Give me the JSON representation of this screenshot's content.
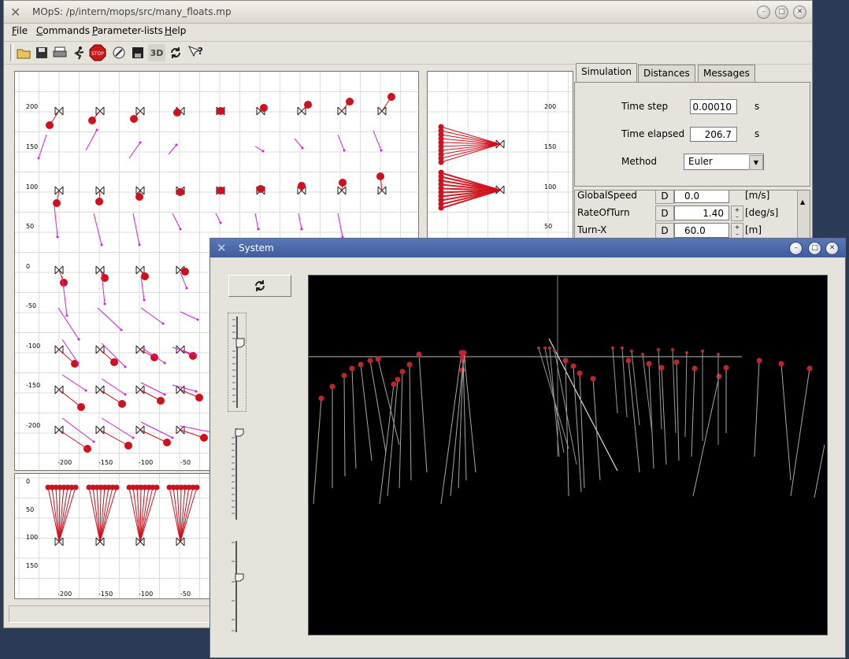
{
  "main_window": {
    "title": "MOpS: /p/intern/mops/src/many_floats.mp",
    "menu": [
      {
        "label": "File"
      },
      {
        "label": "Commands"
      },
      {
        "label": "Parameter-lists"
      },
      {
        "label": "Help"
      }
    ],
    "toolbar_icons": [
      "open-folder-icon",
      "save-icon",
      "print-icon",
      "run-icon",
      "stop-icon",
      "brush-icon",
      "disk-icon",
      "3d-icon",
      "refresh-icon",
      "help-icon"
    ],
    "toolbar_3d_label": "3D",
    "toolbar_stop_label": "STOP"
  },
  "plan_view": {
    "y_ticks": [
      "200",
      "150",
      "100",
      "50",
      "0",
      "-50",
      "-100",
      "-150",
      "-200"
    ],
    "x_ticks": [
      "-200",
      "-150",
      "-100",
      "-50"
    ]
  },
  "side_view": {
    "y_ticks": [
      "200",
      "150",
      "100",
      "50"
    ]
  },
  "front_view": {
    "y_ticks": [
      "0",
      "50",
      "100",
      "150"
    ],
    "x_ticks": [
      "-200",
      "-150",
      "-100",
      "-50"
    ]
  },
  "tabs": [
    {
      "label": "Simulation"
    },
    {
      "label": "Distances"
    },
    {
      "label": "Messages"
    }
  ],
  "simulation": {
    "time_step_label": "Time step",
    "time_step_value": "0.00010",
    "time_step_unit": "s",
    "time_elapsed_label": "Time elapsed",
    "time_elapsed_value": "206.7",
    "time_elapsed_unit": "s",
    "method_label": "Method",
    "method_value": "Euler"
  },
  "params": [
    {
      "name": "GlobalSpeed",
      "d": "D",
      "value": "0.0",
      "unit": "[m/s]"
    },
    {
      "name": "RateOfTurn",
      "d": "D",
      "value": "1.40",
      "unit": "[deg/s]"
    },
    {
      "name": "Turn-X",
      "d": "D",
      "value": "60.0",
      "unit": "[m]"
    }
  ],
  "system_window": {
    "title": "System"
  },
  "colors": {
    "float_red": "#d0101c",
    "vector_magenta": "#d81ae0",
    "titlebar_blue": "#4a68a8"
  }
}
